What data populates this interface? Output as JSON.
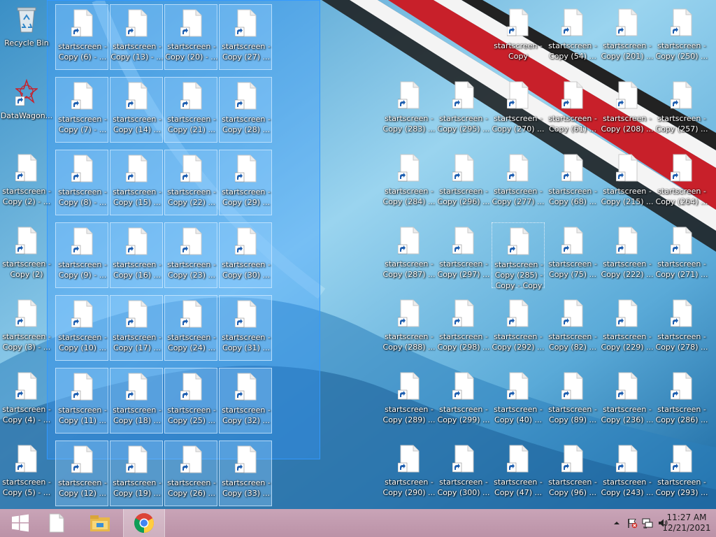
{
  "desktop": {
    "system_icons": [
      {
        "label": "Recycle Bin",
        "icon": "recycle-bin-icon"
      },
      {
        "label": "DataWagon...",
        "icon": "datawagon-icon"
      }
    ],
    "left_column": [
      {
        "l1": "startscreen -",
        "l2": "Copy (2) - ..."
      },
      {
        "l1": "startscreen -",
        "l2": "Copy (2)"
      },
      {
        "l1": "startscreen -",
        "l2": "Copy (3) - ..."
      },
      {
        "l1": "startscreen -",
        "l2": "Copy (4) - ..."
      },
      {
        "l1": "startscreen -",
        "l2": "Copy (5) - ..."
      }
    ],
    "selected_grid": [
      [
        {
          "l1": "startscreen -",
          "l2": "Copy (6) - ..."
        },
        {
          "l1": "startscreen -",
          "l2": "Copy (13) - ..."
        },
        {
          "l1": "startscreen -",
          "l2": "Copy (20) - ..."
        },
        {
          "l1": "startscreen -",
          "l2": "Copy (27) ..."
        }
      ],
      [
        {
          "l1": "startscreen -",
          "l2": "Copy (7) - ..."
        },
        {
          "l1": "startscreen -",
          "l2": "Copy (14) ..."
        },
        {
          "l1": "startscreen -",
          "l2": "Copy (21) ..."
        },
        {
          "l1": "startscreen -",
          "l2": "Copy (28) ..."
        }
      ],
      [
        {
          "l1": "startscreen -",
          "l2": "Copy (8) - ..."
        },
        {
          "l1": "startscreen -",
          "l2": "Copy (15) ..."
        },
        {
          "l1": "startscreen -",
          "l2": "Copy (22) ..."
        },
        {
          "l1": "startscreen -",
          "l2": "Copy (29) ..."
        }
      ],
      [
        {
          "l1": "startscreen -",
          "l2": "Copy (9) - ..."
        },
        {
          "l1": "startscreen -",
          "l2": "Copy (16) ..."
        },
        {
          "l1": "startscreen -",
          "l2": "Copy (23) ..."
        },
        {
          "l1": "startscreen -",
          "l2": "Copy (30) ..."
        }
      ],
      [
        {
          "l1": "startscreen -",
          "l2": "Copy (10) ..."
        },
        {
          "l1": "startscreen -",
          "l2": "Copy (17) ..."
        },
        {
          "l1": "startscreen -",
          "l2": "Copy (24) ..."
        },
        {
          "l1": "startscreen -",
          "l2": "Copy (31) ..."
        }
      ],
      [
        {
          "l1": "startscreen -",
          "l2": "Copy (11) ..."
        },
        {
          "l1": "startscreen -",
          "l2": "Copy (18) ..."
        },
        {
          "l1": "startscreen -",
          "l2": "Copy (25) ..."
        },
        {
          "l1": "startscreen -",
          "l2": "Copy (32) ..."
        }
      ],
      [
        {
          "l1": "startscreen -",
          "l2": "Copy (12) ..."
        },
        {
          "l1": "startscreen -",
          "l2": "Copy (19) ..."
        },
        {
          "l1": "startscreen -",
          "l2": "Copy (26) ..."
        },
        {
          "l1": "startscreen -",
          "l2": "Copy (33) ..."
        }
      ]
    ],
    "right_grid": [
      [
        null,
        null,
        {
          "l1": "startscreen -",
          "l2": "Copy"
        },
        {
          "l1": "startscreen -",
          "l2": "Copy (54) ..."
        },
        {
          "l1": "startscreen -",
          "l2": "Copy (201) ..."
        },
        {
          "l1": "startscreen -",
          "l2": "Copy (250) ..."
        }
      ],
      [
        {
          "l1": "startscreen -",
          "l2": "Copy (283) ..."
        },
        {
          "l1": "startscreen -",
          "l2": "Copy (295) ..."
        },
        {
          "l1": "startscreen -",
          "l2": "Copy (270) ..."
        },
        {
          "l1": "startscreen -",
          "l2": "Copy (61) ..."
        },
        {
          "l1": "startscreen -",
          "l2": "Copy (208) ..."
        },
        {
          "l1": "startscreen -",
          "l2": "Copy (257) ..."
        }
      ],
      [
        {
          "l1": "startscreen -",
          "l2": "Copy (284) ..."
        },
        {
          "l1": "startscreen -",
          "l2": "Copy (296) ..."
        },
        {
          "l1": "startscreen -",
          "l2": "Copy (277) ..."
        },
        {
          "l1": "startscreen -",
          "l2": "Copy (68) ..."
        },
        {
          "l1": "startscreen -",
          "l2": "Copy (215) ..."
        },
        {
          "l1": "startscreen -",
          "l2": "Copy (264) ..."
        }
      ],
      [
        {
          "l1": "startscreen -",
          "l2": "Copy (287) ..."
        },
        {
          "l1": "startscreen -",
          "l2": "Copy (297) ..."
        },
        {
          "l1": "startscreen -",
          "l2": "Copy (285) -",
          "l3": "Copy - Copy"
        },
        {
          "l1": "startscreen -",
          "l2": "Copy (75) ..."
        },
        {
          "l1": "startscreen -",
          "l2": "Copy (222) ..."
        },
        {
          "l1": "startscreen -",
          "l2": "Copy (271) ..."
        }
      ],
      [
        {
          "l1": "startscreen -",
          "l2": "Copy (288) ..."
        },
        {
          "l1": "startscreen -",
          "l2": "Copy (298) ..."
        },
        {
          "l1": "startscreen -",
          "l2": "Copy (292) ..."
        },
        {
          "l1": "startscreen -",
          "l2": "Copy (82) ..."
        },
        {
          "l1": "startscreen -",
          "l2": "Copy (229) ..."
        },
        {
          "l1": "startscreen -",
          "l2": "Copy (278) ..."
        }
      ],
      [
        {
          "l1": "startscreen -",
          "l2": "Copy (289) ..."
        },
        {
          "l1": "startscreen -",
          "l2": "Copy (299) ..."
        },
        {
          "l1": "startscreen -",
          "l2": "Copy (40) ..."
        },
        {
          "l1": "startscreen -",
          "l2": "Copy (89) ..."
        },
        {
          "l1": "startscreen -",
          "l2": "Copy (236) ..."
        },
        {
          "l1": "startscreen -",
          "l2": "Copy (286) ..."
        }
      ],
      [
        {
          "l1": "startscreen -",
          "l2": "Copy (290) ..."
        },
        {
          "l1": "startscreen -",
          "l2": "Copy (300) ..."
        },
        {
          "l1": "startscreen -",
          "l2": "Copy (47) ..."
        },
        {
          "l1": "startscreen -",
          "l2": "Copy (96) ..."
        },
        {
          "l1": "startscreen -",
          "l2": "Copy (243) ..."
        },
        {
          "l1": "startscreen -",
          "l2": "Copy (293) ..."
        }
      ]
    ]
  },
  "taskbar": {
    "buttons": [
      {
        "icon": "windows-start-icon"
      },
      {
        "icon": "blank-document-icon"
      },
      {
        "icon": "file-explorer-icon"
      },
      {
        "icon": "chrome-icon",
        "active": true
      }
    ],
    "tray": {
      "icons": [
        "show-hidden-icons-chevron-icon",
        "action-center-flag-icon",
        "network-icon",
        "volume-icon"
      ],
      "time": "11:27 AM",
      "date": "12/21/2021"
    }
  },
  "colors": {
    "selection_fill": "#3399ff",
    "taskbar": "#c29bb0",
    "wallpaper_red": "#c8202a"
  }
}
